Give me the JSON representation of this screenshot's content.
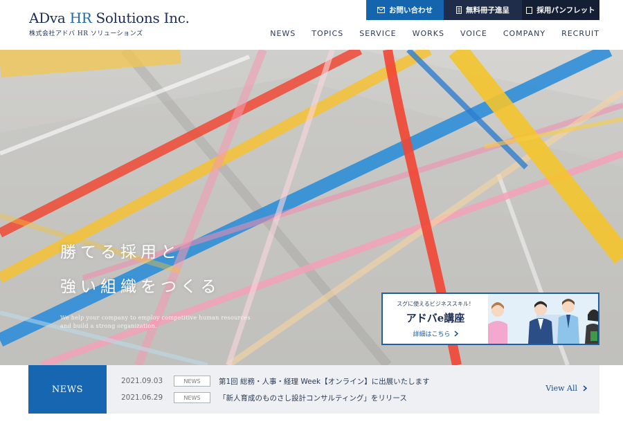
{
  "header": {
    "logo_main_a": "ADva ",
    "logo_main_b": "HR",
    "logo_main_c": " Solutions Inc.",
    "logo_sub": "株式会社アドバ HR ソリューションズ",
    "buttons": {
      "contact": "お問い合わせ",
      "material": "無料冊子進呈",
      "pamphlet": "採用パンフレット"
    },
    "nav": [
      "NEWS",
      "TOPICS",
      "SERVICE",
      "WORKS",
      "VOICE",
      "COMPANY",
      "RECRUIT"
    ]
  },
  "hero": {
    "catch_line1": "勝てる採用と",
    "catch_line2": "強い組織をつくる",
    "catch_en": "We help your company to employ competitive human resources and build a strong organization."
  },
  "banner": {
    "top": "スグに使えるビジネススキル！",
    "title": "アドバe講座",
    "link": "詳細はこちら"
  },
  "news": {
    "label": "NEWS",
    "items": [
      {
        "date": "2021.09.03",
        "tag": "NEWS",
        "title": "第1回 総務・人事・経理 Week【オンライン】に出展いたします"
      },
      {
        "date": "2021.06.29",
        "tag": "NEWS",
        "title": "「新人育成のものさし設計コンサルティング」をリリース"
      }
    ],
    "view_all": "View All"
  },
  "colors": {
    "primary_blue": "#1766b1",
    "navy": "#1f2d4b",
    "dark_navy": "#141e34"
  }
}
